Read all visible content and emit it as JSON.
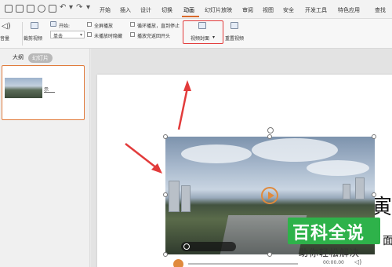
{
  "tabs": [
    "开始",
    "插入",
    "设计",
    "切换",
    "动画",
    "幻灯片放映",
    "审阅",
    "视图",
    "安全",
    "开发工具",
    "特色应用",
    "查找"
  ],
  "active_tab_index": 4,
  "accent_color": "#d96a2b",
  "highlight_color": "#e23b3b",
  "ribbon": {
    "volume_label": "音量",
    "trim_label": "裁剪视频",
    "start_label": "开始:",
    "start_value": "单击",
    "fullscreen_label": "全屏播放",
    "hide_label": "未播放时隐藏",
    "loop_label": "循环播放，直到停止",
    "rewind_label": "播放完返回开头",
    "cover_label": "视频封面",
    "reset_label": "重置视频"
  },
  "left_panel": {
    "tab_outline": "大纲",
    "tab_slides": "幻灯片",
    "thumb_text": "示"
  },
  "slide": {
    "side_char_1": "寅",
    "side_char_2": "面"
  },
  "player": {
    "time": "00:00.00"
  },
  "watermark": {
    "title": "百科全说",
    "subtitle": "助你轻松解决"
  }
}
